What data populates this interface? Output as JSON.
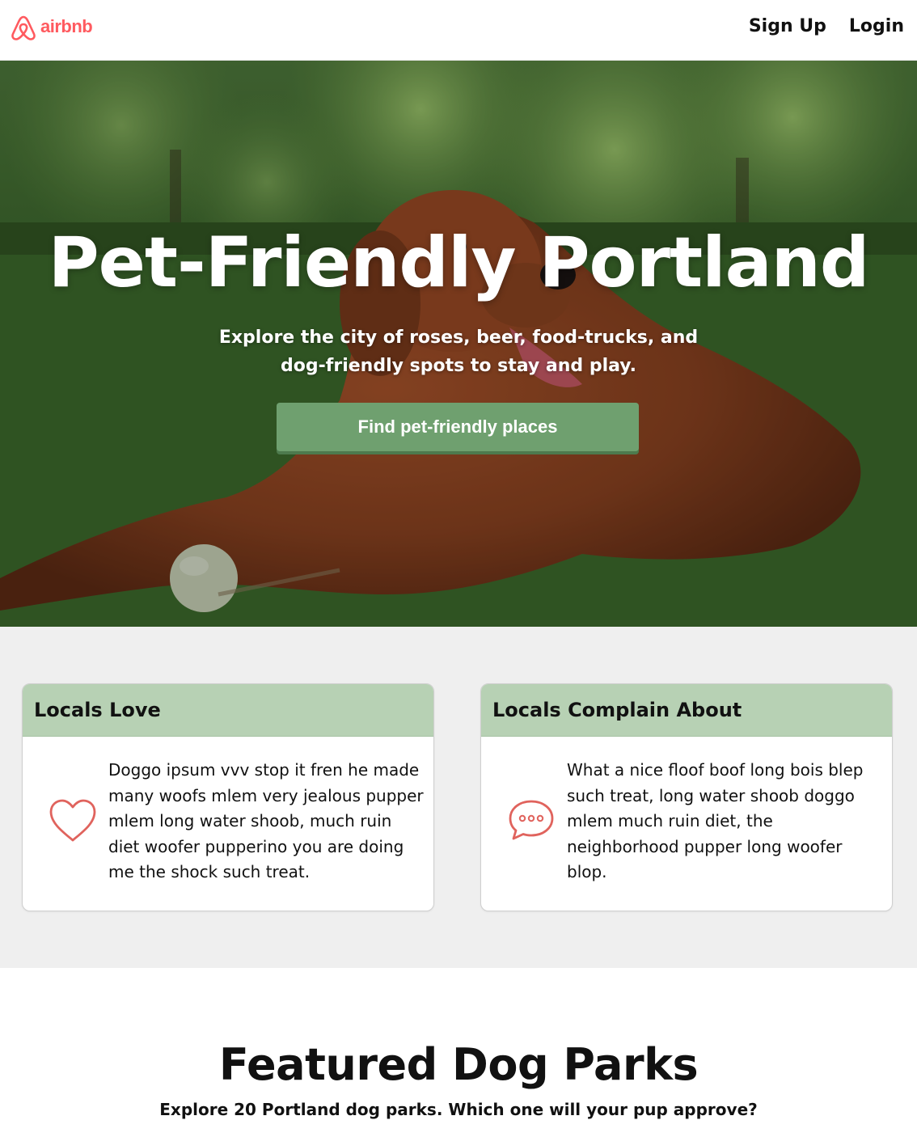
{
  "header": {
    "logo_text": "airbnb",
    "nav": {
      "signup": "Sign Up",
      "login": "Login"
    }
  },
  "hero": {
    "title": "Pet-Friendly Portland",
    "subtitle": "Explore the city of roses, beer, food-trucks, and dog-friendly spots to stay and play.",
    "cta": "Find pet-friendly places"
  },
  "locals": {
    "love": {
      "title": "Locals Love",
      "icon": "heart-icon",
      "text": "Doggo ipsum vvv stop it fren he made many woofs mlem very jealous pupper mlem long water shoob, much ruin diet woofer pupperino you are doing me the shock such treat."
    },
    "complain": {
      "title": "Locals Complain About",
      "icon": "chat-bubble-icon",
      "text": "What a nice floof boof long bois blep such treat, long water shoob doggo mlem much ruin diet, the neighborhood pupper long woofer blop."
    }
  },
  "featured": {
    "title": "Featured Dog Parks",
    "subtitle": "Explore 20 Portland dog parks. Which one will your pup approve?"
  },
  "colors": {
    "brand": "#ff5a5f",
    "cta": "#6fa06f",
    "card_header": "#b7d1b4",
    "section_bg": "#efefef",
    "icon": "#e0635d"
  }
}
